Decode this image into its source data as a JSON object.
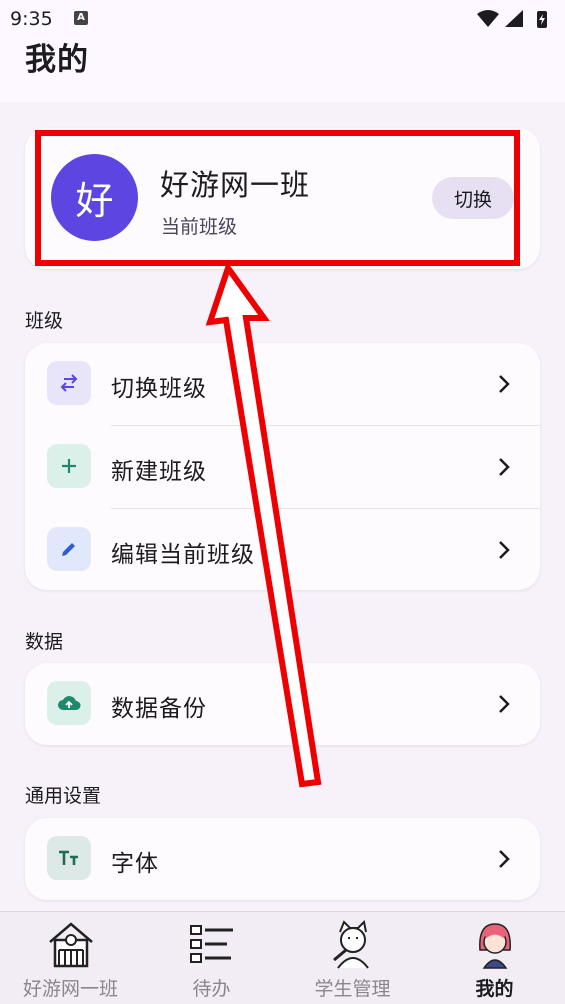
{
  "status_bar": {
    "time": "9:35",
    "notification_icon": "A"
  },
  "header": {
    "title": "我的"
  },
  "current_class": {
    "avatar_char": "好",
    "name": "好游网一班",
    "subtitle": "当前班级",
    "switch_label": "切换"
  },
  "sections": {
    "class": {
      "title": "班级",
      "items": [
        {
          "label": "切换班级",
          "icon": "swap-icon"
        },
        {
          "label": "新建班级",
          "icon": "plus-icon"
        },
        {
          "label": "编辑当前班级",
          "icon": "pencil-icon"
        }
      ]
    },
    "data": {
      "title": "数据",
      "items": [
        {
          "label": "数据备份",
          "icon": "cloud-upload-icon"
        }
      ]
    },
    "general": {
      "title": "通用设置",
      "items": [
        {
          "label": "字体",
          "icon": "font-size-icon"
        }
      ]
    }
  },
  "bottom_nav": {
    "items": [
      {
        "label": "好游网一班",
        "icon": "school-house-icon",
        "active": false
      },
      {
        "label": "待办",
        "icon": "checklist-icon",
        "active": false
      },
      {
        "label": "学生管理",
        "icon": "student-cat-icon",
        "active": false
      },
      {
        "label": "我的",
        "icon": "girl-avatar-icon",
        "active": true
      }
    ]
  },
  "colors": {
    "accent": "#5c45e0",
    "annotation_red": "#ee0000",
    "background": "#f7f2f9"
  }
}
